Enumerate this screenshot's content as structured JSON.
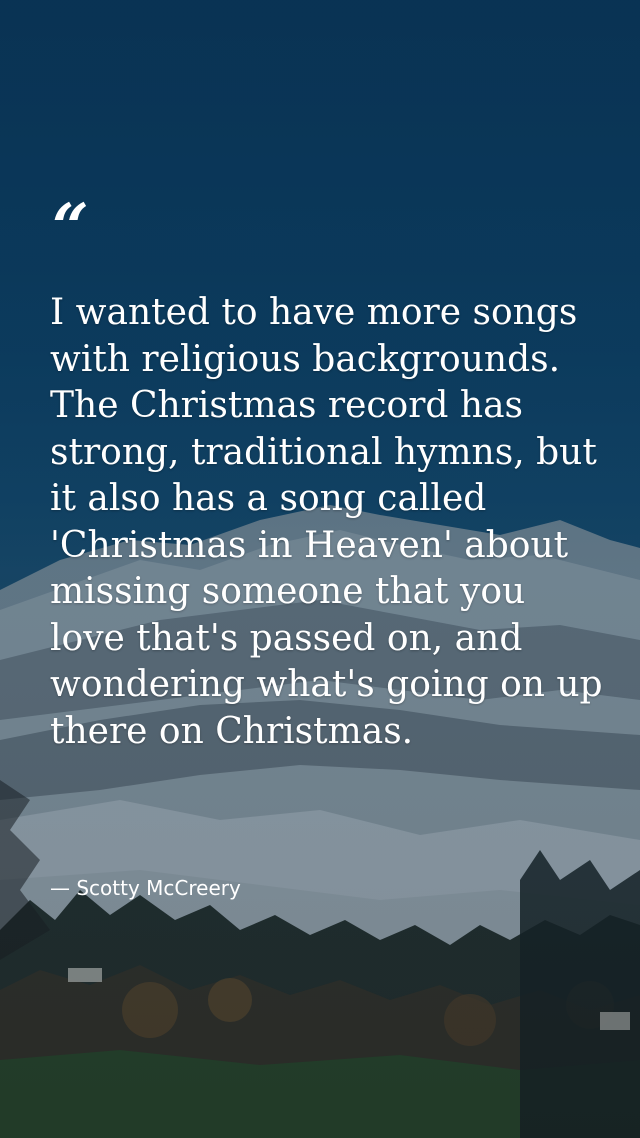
{
  "quote": {
    "mark": "“",
    "text": "I wanted to have more songs with religious backgrounds. The Christmas record has strong, traditional hymns, but it also has a song called 'Christmas in Heaven' about missing someone that you love that's passed on, and wondering what's going on up there on Christmas.",
    "attribution": "— Scotty McCreery"
  },
  "colors": {
    "sky": "#0b3a5c",
    "text": "#ffffff"
  }
}
